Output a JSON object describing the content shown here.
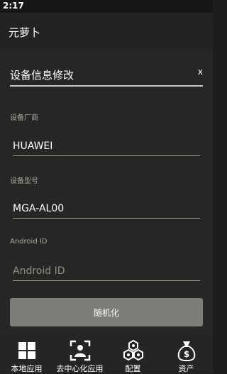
{
  "status_bar": {
    "time": "2:17"
  },
  "app": {
    "title": "元萝卜"
  },
  "dialog": {
    "title": "设备信息修改",
    "close_label": "x",
    "fields": {
      "manufacturer": {
        "label": "设备厂商",
        "value": "HUAWEI",
        "placeholder": ""
      },
      "model": {
        "label": "设备型号",
        "value": "MGA-AL00",
        "placeholder": ""
      },
      "android_id": {
        "label": "Android ID",
        "value": "",
        "placeholder": "Android ID"
      }
    },
    "randomize_label": "随机化"
  },
  "bottom_nav": {
    "items": [
      {
        "label": "本地应用",
        "icon": "grid-icon"
      },
      {
        "label": "去中心化应用",
        "icon": "scan-person-icon"
      },
      {
        "label": "配置",
        "icon": "hexagons-icon"
      },
      {
        "label": "资产",
        "icon": "money-bag-icon"
      }
    ]
  },
  "colors": {
    "background": "#1d1d1b",
    "dialog": "#262624",
    "button": "#7d7d79",
    "label": "#a8a8a3"
  }
}
